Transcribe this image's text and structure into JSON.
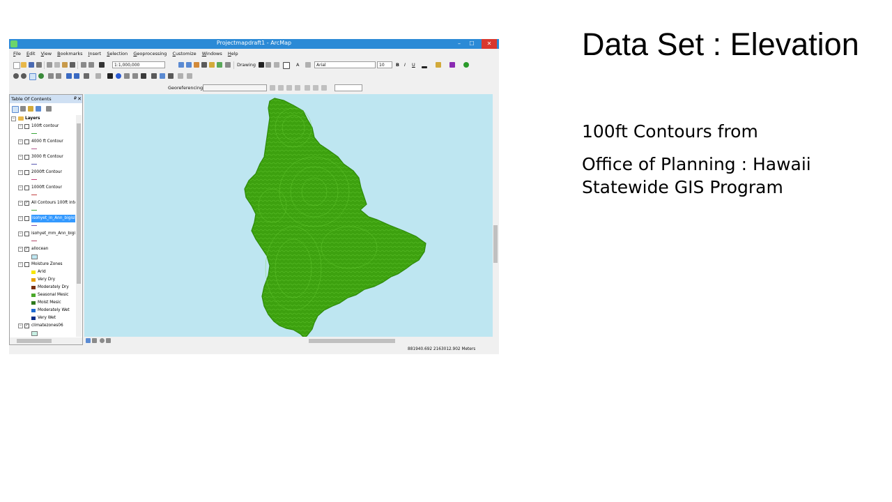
{
  "slide": {
    "title": "Data Set : Elevation",
    "body": [
      "100ft Contours from",
      "Office of Planning : Hawaii Statewide GIS Program"
    ]
  },
  "window": {
    "title": "Projectmapdraft1 - ArcMap",
    "controls": [
      "–",
      "☐",
      "✕"
    ]
  },
  "menu": [
    "File",
    "Edit",
    "View",
    "Bookmarks",
    "Insert",
    "Selection",
    "Geoprocessing",
    "Customize",
    "Windows",
    "Help"
  ],
  "toolbar": {
    "scale": "1:1,000,000",
    "drawing_label": "Drawing",
    "font_name": "Arial",
    "font_size": "10",
    "bold": "B",
    "italic": "I",
    "underline": "U",
    "text_tool": "A",
    "georeferencing_label": "Georeferencing"
  },
  "toc": {
    "title": "Table Of Contents",
    "pin": "₽",
    "close": "✕",
    "root": "Layers",
    "layers": [
      {
        "name": "100ft contour",
        "checked": false,
        "symbol": "line",
        "color": "#3aa83a"
      },
      {
        "name": "4000 ft Contour",
        "checked": false,
        "symbol": "line",
        "color": "#b25a8e"
      },
      {
        "name": "3000 ft Contour",
        "checked": false,
        "symbol": "line",
        "color": "#5a5ab2"
      },
      {
        "name": "2000ft Contour",
        "checked": false,
        "symbol": "line",
        "color": "#c2417a"
      },
      {
        "name": "1000ft Contour",
        "checked": false,
        "symbol": "line",
        "color": "#c24141"
      },
      {
        "name": "All Contours 100ft inte",
        "checked": true,
        "symbol": "line",
        "color": "#3aa83a"
      },
      {
        "name": "isohyet_in_Ann_bigisla",
        "checked": false,
        "symbol": "line",
        "color": "#7a55b2",
        "selected": true
      },
      {
        "name": "isohyet_mm_Ann_bigi",
        "checked": false,
        "symbol": "line",
        "color": "#b24a6a"
      },
      {
        "name": "allocean",
        "checked": true,
        "symbol": "box",
        "color": "#bee6f1"
      },
      {
        "name": "Moisture Zones",
        "checked": false,
        "symbol": "none",
        "color": ""
      }
    ],
    "moisture_zones": [
      {
        "label": "Arid",
        "color": "#f7e600"
      },
      {
        "label": "Very Dry",
        "color": "#e8a000"
      },
      {
        "label": "Moderately Dry",
        "color": "#7a3010"
      },
      {
        "label": "Seasonal Mesic",
        "color": "#4aa82a"
      },
      {
        "label": "Moist Mesic",
        "color": "#2e7a1e"
      },
      {
        "label": "Moderately Wet",
        "color": "#1e6ad2"
      },
      {
        "label": "Very Wet",
        "color": "#0a2e8a"
      }
    ],
    "last_layer": {
      "name": "climatezones06",
      "checked": true,
      "color": "#c8f0e4"
    }
  },
  "map": {
    "ocean_color": "#bee6f1",
    "land_color": "#3da10f"
  },
  "status": {
    "coordinates": "881940.692  2163012.902 Meters"
  }
}
